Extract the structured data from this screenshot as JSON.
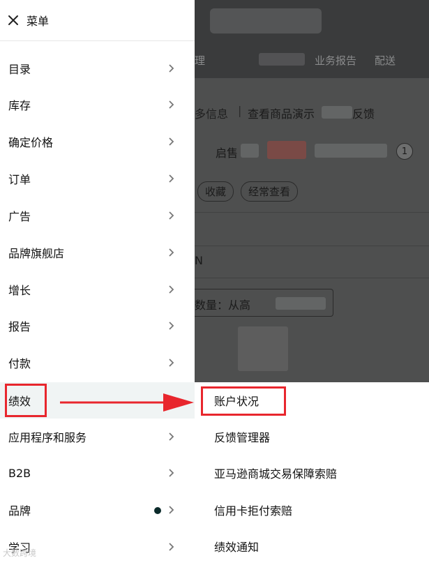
{
  "menu": {
    "title": "菜单",
    "close_icon": "close-icon",
    "items": [
      {
        "label": "目录",
        "icon": "chevron-right-icon"
      },
      {
        "label": "库存",
        "icon": "chevron-right-icon"
      },
      {
        "label": "确定价格",
        "icon": "chevron-right-icon"
      },
      {
        "label": "订单",
        "icon": "chevron-right-icon"
      },
      {
        "label": "广告",
        "icon": "chevron-right-icon"
      },
      {
        "label": "品牌旗舰店",
        "icon": "chevron-right-icon"
      },
      {
        "label": "增长",
        "icon": "chevron-right-icon"
      },
      {
        "label": "报告",
        "icon": "chevron-right-icon"
      },
      {
        "label": "付款",
        "icon": "chevron-right-icon"
      },
      {
        "label": "绩效",
        "active": true
      },
      {
        "label": "应用程序和服务",
        "icon": "chevron-right-icon"
      },
      {
        "label": "B2B",
        "icon": "chevron-right-icon"
      },
      {
        "label": "品牌",
        "icon": "chevron-right-icon",
        "badge_dot": true
      },
      {
        "label": "学习",
        "icon": "chevron-right-icon"
      }
    ]
  },
  "submenu": {
    "items": [
      {
        "label": "账户状况",
        "highlighted": true
      },
      {
        "label": "反馈管理器"
      },
      {
        "label": "亚马逊商城交易保障索赔"
      },
      {
        "label": "信用卡拒付索赔"
      },
      {
        "label": "绩效通知"
      }
    ]
  },
  "background_page": {
    "nav": [
      "理",
      "业务报告",
      "配送"
    ],
    "links": [
      "多信息",
      "查看商品演示",
      "反馈"
    ],
    "notice_prefix": "启售",
    "notice_count": "1",
    "chips": [
      "收藏",
      "经常查看"
    ],
    "field_fragment": "N",
    "sort_label": "数量：从高"
  },
  "watermark": "大数跨境",
  "colors": {
    "annotation_red": "#e8262d",
    "overlay": "#4e4f4f",
    "active_bg": "#f0f4f4"
  }
}
